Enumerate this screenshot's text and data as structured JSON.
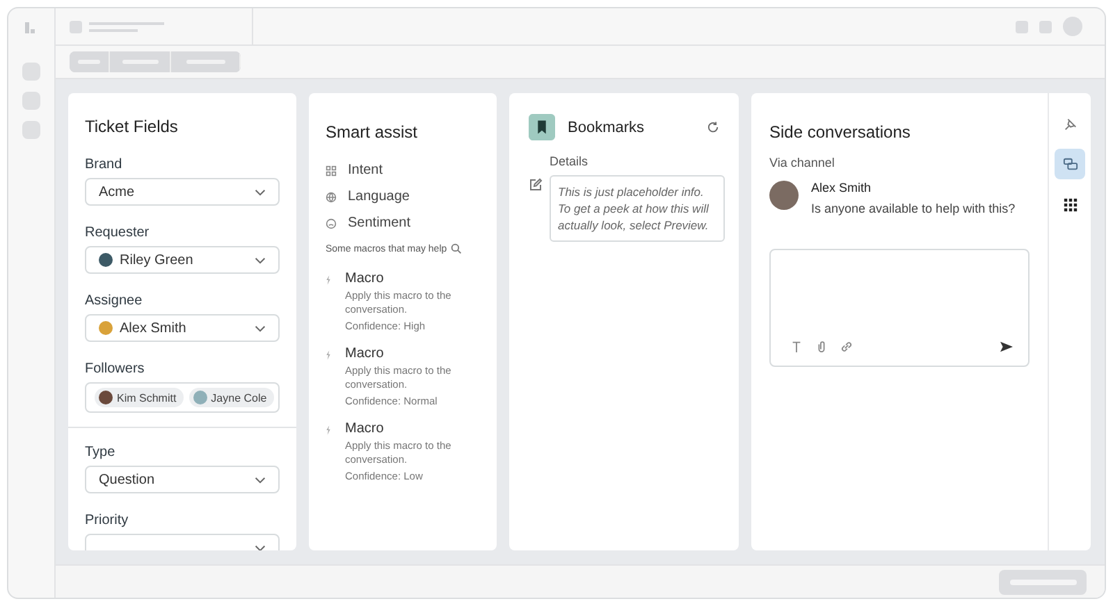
{
  "ticket_fields": {
    "title": "Ticket Fields",
    "fields": [
      {
        "label": "Brand",
        "kind": "select",
        "value": "Acme"
      },
      {
        "label": "Requester",
        "kind": "person",
        "value": "Riley Green"
      },
      {
        "label": "Assignee",
        "kind": "person",
        "value": "Alex Smith"
      },
      {
        "label": "Followers",
        "kind": "chips",
        "chips": [
          "Kim Schmitt",
          "Jayne Cole"
        ]
      }
    ],
    "more_fields": [
      {
        "label": "Type",
        "kind": "select",
        "value": "Question"
      },
      {
        "label": "Priority",
        "kind": "select"
      }
    ]
  },
  "smart_assist": {
    "title": "Smart assist",
    "items": [
      {
        "label": "Intent",
        "kind": "intent"
      },
      {
        "label": "Language",
        "kind": "language"
      },
      {
        "label": "Sentiment",
        "kind": "sentiment"
      }
    ],
    "macros_heading": "Some macros that may help",
    "macros": [
      {
        "title": "Macro",
        "description": "Apply this macro to the conversation.",
        "confidence": "Confidence: High"
      },
      {
        "title": "Macro",
        "description": "Apply this macro to the conversation.",
        "confidence": "Confidence: Normal"
      },
      {
        "title": "Macro",
        "description": "Apply this macro to the conversation.",
        "confidence": "Confidence: Low"
      }
    ]
  },
  "bookmarks": {
    "title": "Bookmarks",
    "details_label": "Details",
    "details_text": "This is just placeholder info. To get a peek at how this will actually look, select Preview."
  },
  "side_conversations": {
    "title": "Side conversations",
    "channel": "Via channel",
    "message": {
      "author": "Alex Smith",
      "text": "Is anyone available to help with this?"
    }
  },
  "rail": [
    {
      "kind": "pin",
      "selected": false
    },
    {
      "kind": "chat",
      "selected": true
    },
    {
      "kind": "apps",
      "selected": false
    }
  ]
}
